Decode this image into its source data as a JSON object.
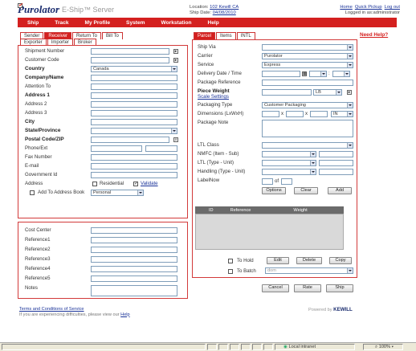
{
  "header": {
    "brand": "Purolator",
    "product": "E-Ship™ Server",
    "location_label": "Location:",
    "location_value": "102 Kewill CA",
    "ship_date_label": "Ship Date:",
    "ship_date_value": "04/08/2010",
    "links": [
      "Home",
      "Quick Pickup",
      "Log out"
    ],
    "logged_in": "Logged in as:administrator"
  },
  "menu": [
    "Ship",
    "Track",
    "My Profile",
    "System",
    "Workstation",
    "Help"
  ],
  "left_tabs_row1": [
    "Sender",
    "Receiver",
    "Return To",
    "Bill To"
  ],
  "left_tabs_row2": [
    "Exporter",
    "Importer",
    "Broker"
  ],
  "address_form": {
    "shipment_number": "Shipment Number",
    "customer_code": "Customer Code",
    "country": "Country",
    "country_value": "Canada",
    "company": "Company/Name",
    "attention": "Attention To",
    "address1": "Address 1",
    "address2": "Address 2",
    "address3": "Address 3",
    "city": "City",
    "state": "State/Province",
    "postal": "Postal Code/ZIP",
    "phone": "Phone/Ext",
    "fax": "Fax Number",
    "email": "E-mail",
    "govt": "Government Id",
    "address_type": "Address",
    "residential": "Residential",
    "validate": "Validate",
    "add_to_book": "Add To Address Book",
    "book_value": "Personal"
  },
  "reference_form": {
    "cost_center": "Cost Center",
    "ref1": "Reference1",
    "ref2": "Reference2",
    "ref3": "Reference3",
    "ref4": "Reference4",
    "ref5": "Reference5",
    "notes": "Notes"
  },
  "right_tabs": [
    "Parcel",
    "Items",
    "INTL"
  ],
  "need_help": "Need Help?",
  "parcel_form": {
    "ship_via": "Ship Via",
    "carrier": "Carrier",
    "carrier_value": "Purolator",
    "service": "Service",
    "service_value": "Express",
    "delivery": "Delivery Date / Time",
    "package_ref": "Package Reference",
    "piece_weight": "Piece Weight",
    "weight_unit": "LB",
    "scale_settings": "Scale Settings",
    "packaging_type": "Packaging Type",
    "packaging_value": "Customer Packaging",
    "dimensions": "Dimensions (LxWxH)",
    "dim_x": "x",
    "dim_unit": "IN",
    "package_note": "Package Note",
    "ltl_class": "LTL Class",
    "nmfc": "NMFC (Item - Sub)",
    "ltl_type": "LTL (Type - Unit)",
    "handling": "Handling (Type - Unit)",
    "label_now": "LabelNow",
    "of": "of",
    "options_btn": "Options",
    "clear_btn": "Clear",
    "add_btn": "Add",
    "col_id": "ID",
    "col_ref": "Reference",
    "col_weight": "Weight",
    "to_hold": "To Hold",
    "edit_btn": "Edit",
    "delete_btn": "Delete",
    "copy_btn": "Copy",
    "to_batch": "To Batch",
    "batch_value": "dom"
  },
  "actions": {
    "cancel": "Cancel",
    "rate": "Rate",
    "ship": "Ship"
  },
  "footer": {
    "terms": "Terms and Conditions of Service",
    "note_prefix": "If you are experiencing difficulties, please view our",
    "help": "Help",
    "powered": "Powered by",
    "kewill": "KEWILL"
  },
  "status_bar": {
    "zone": "Local intranet",
    "zoom": "100%"
  },
  "colors": {
    "accent": "#d4201f",
    "brand": "#1a2c6e"
  }
}
